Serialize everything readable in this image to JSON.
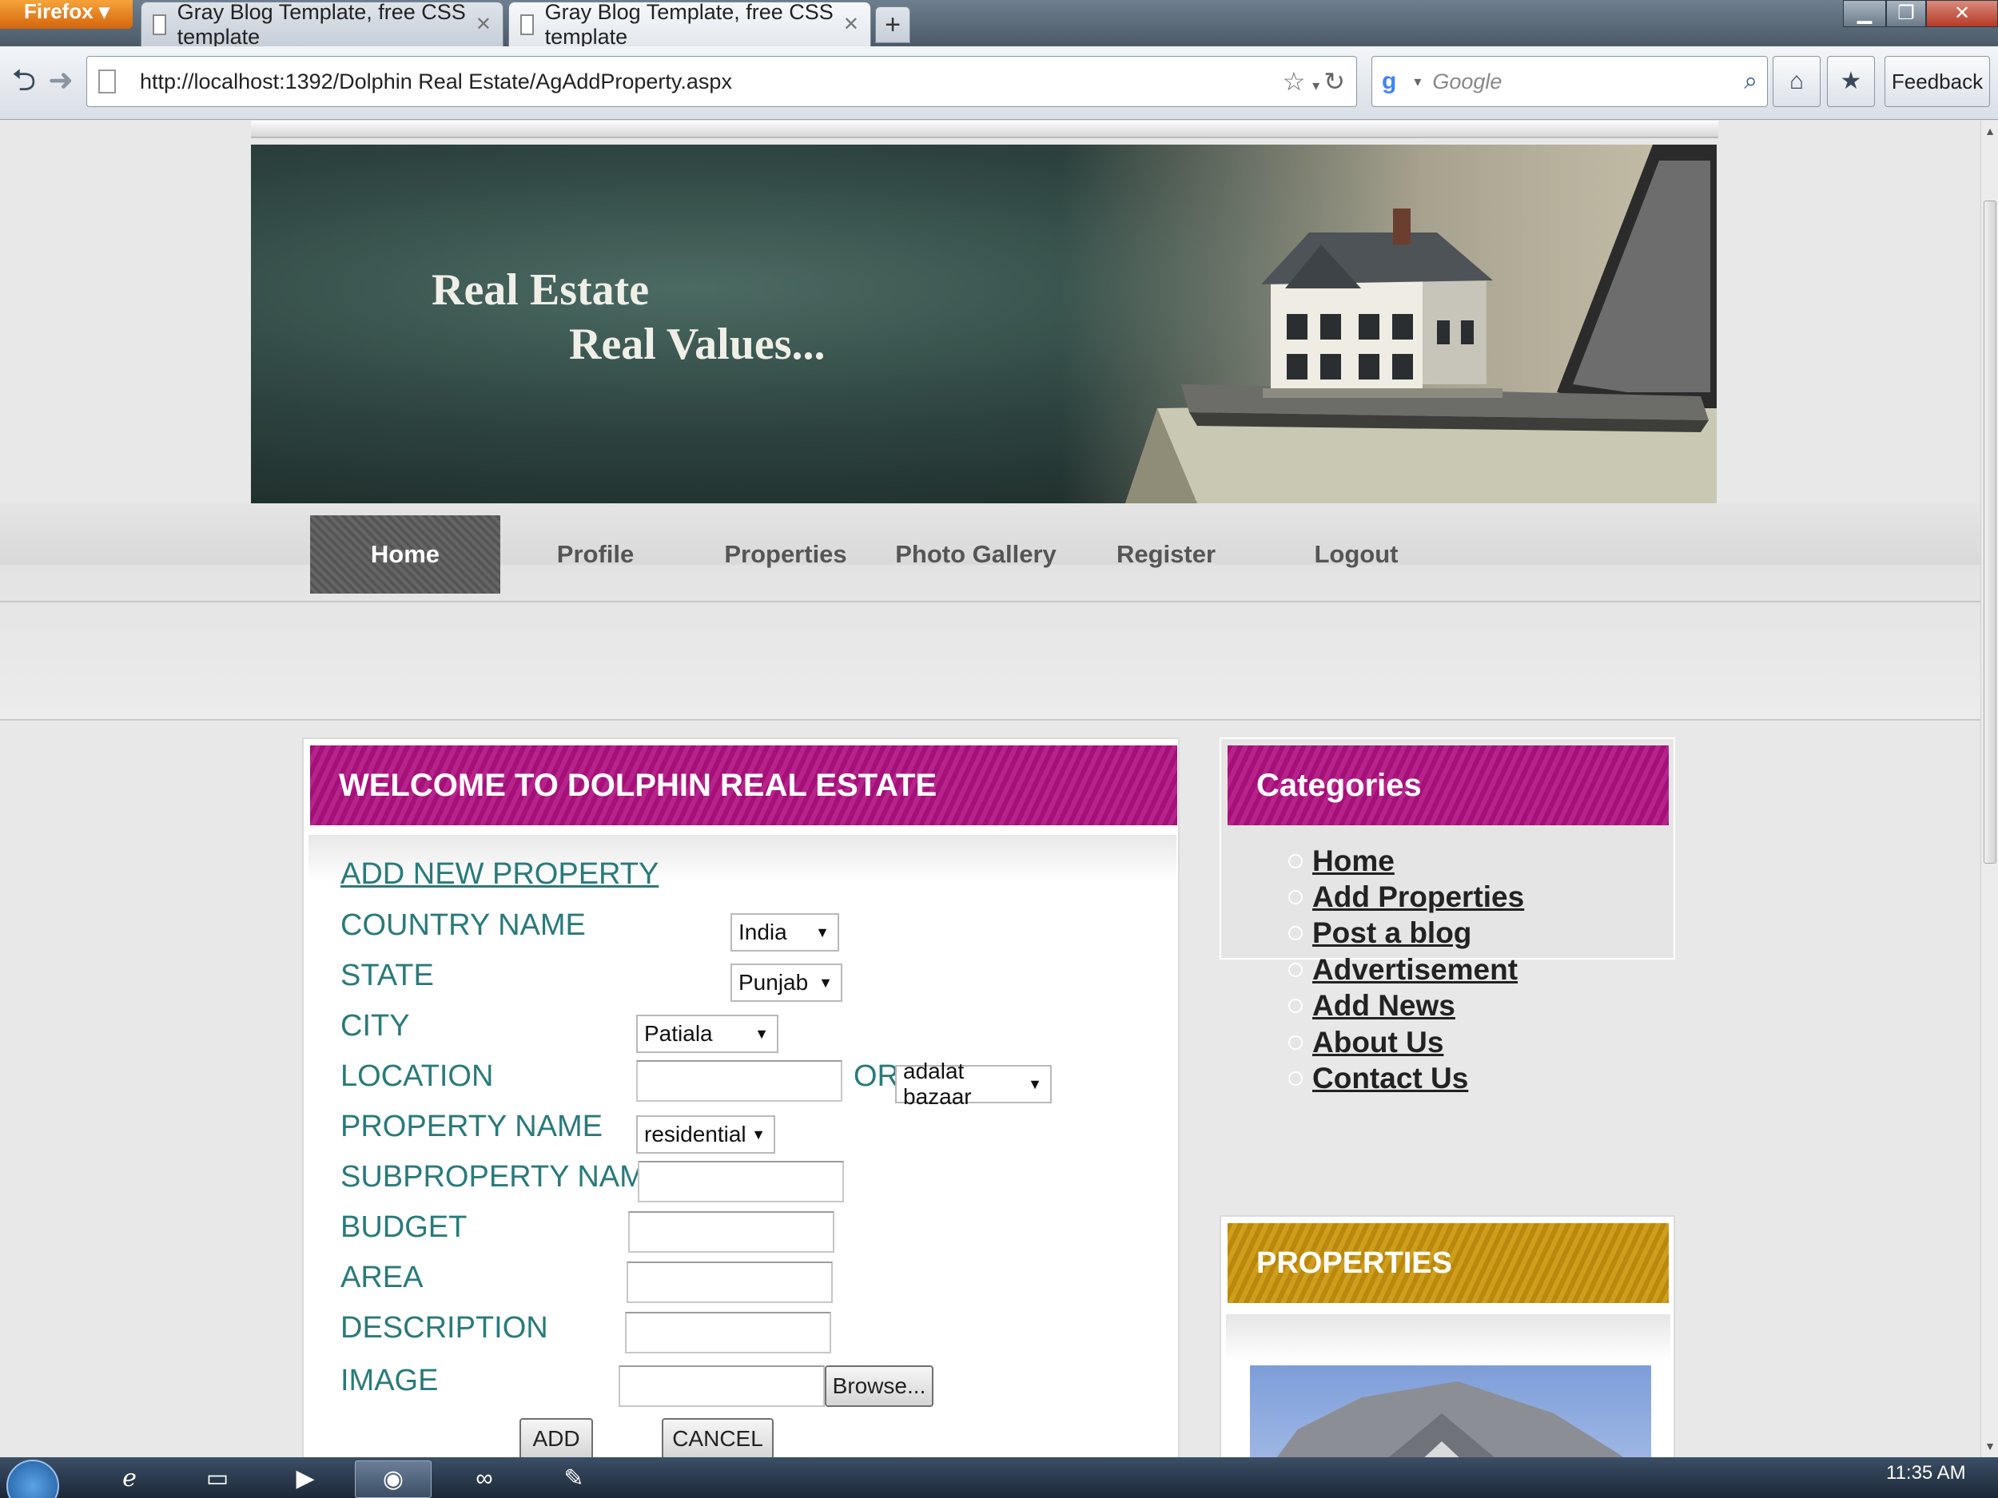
{
  "browser": {
    "app_button": "Firefox",
    "tabs": [
      {
        "label": "Gray Blog Template, free CSS template",
        "active": false
      },
      {
        "label": "Gray Blog Template, free CSS template",
        "active": true
      }
    ],
    "new_tab": "+",
    "url": "http://localhost:1392/Dolphin Real Estate/AgAddProperty.aspx",
    "search_engine": "Google",
    "search_placeholder": "Google",
    "feedback_label": "Feedback",
    "icons": [
      "back-icon",
      "forward-icon",
      "bookmark-star-icon",
      "reload-icon",
      "search-icon",
      "home-icon",
      "bookmarks-icon"
    ]
  },
  "banner": {
    "line1": "Real Estate",
    "line2": "Real Values..."
  },
  "menu": {
    "items": [
      {
        "label": "Home",
        "active": true
      },
      {
        "label": "Profile",
        "active": false
      },
      {
        "label": "Properties",
        "active": false
      },
      {
        "label": "Photo Gallery",
        "active": false
      },
      {
        "label": "Register",
        "active": false
      },
      {
        "label": "Logout",
        "active": false
      }
    ]
  },
  "form": {
    "header": "WELCOME TO DOLPHIN REAL ESTATE",
    "title_link": "ADD NEW PROPERTY",
    "labels": {
      "country": "COUNTRY NAME",
      "state": "STATE",
      "city": "CITY",
      "location": "LOCATION",
      "or": "OR",
      "property_name": "PROPERTY NAME",
      "subproperty": "SUBPROPERTY NAME",
      "budget": "BUDGET",
      "area": "AREA",
      "description": "DESCRIPTION",
      "image": "IMAGE"
    },
    "values": {
      "country": "India",
      "state": "Punjab",
      "city": "Patiala",
      "location_select": "adalat bazaar",
      "property_name": "residential"
    },
    "browse_button": "Browse...",
    "add_button": "ADD",
    "cancel_button": "CANCEL"
  },
  "categories": {
    "header": "Categories",
    "items": [
      "Home",
      "Add Properties",
      "Post a blog",
      "Advertisement",
      "Add News",
      "About Us",
      "Contact Us"
    ]
  },
  "properties_panel": {
    "header": "PROPERTIES"
  },
  "colors": {
    "pink_header": "#a50f78",
    "gold_header": "#c0900f",
    "teal_text": "#2a7a7a",
    "active_menu": "#5a5a5a"
  },
  "taskbar": {
    "clock": "11:35 AM",
    "apps": [
      "internet-explorer-icon",
      "folder-icon",
      "media-icon",
      "firefox-icon",
      "visual-studio-icon",
      "notes-icon"
    ]
  }
}
